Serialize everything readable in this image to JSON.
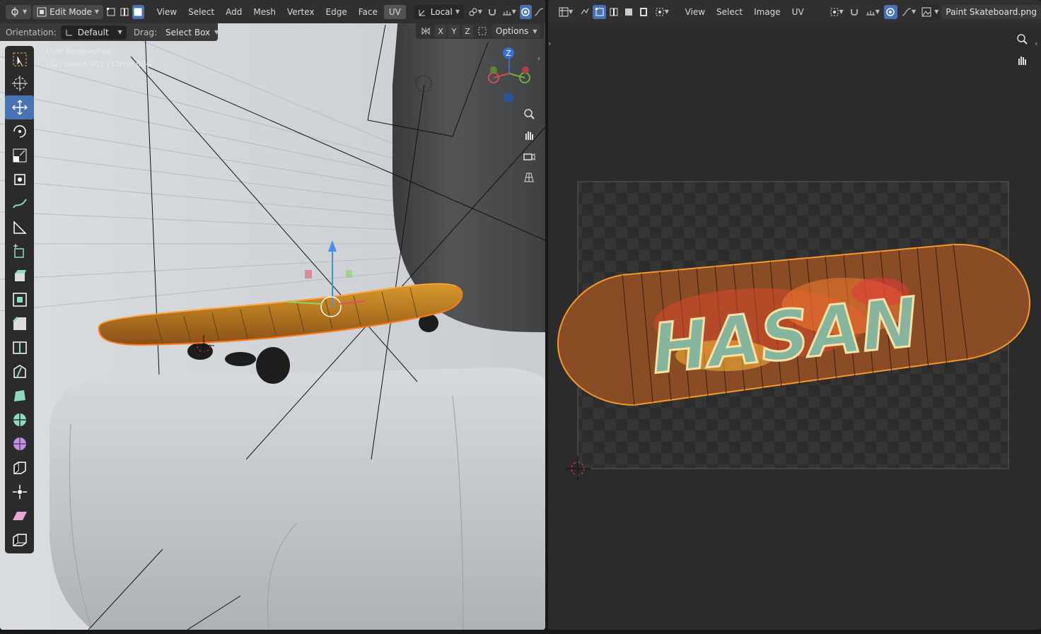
{
  "viewport": {
    "mode_label": "Edit Mode",
    "menus": [
      "View",
      "Select",
      "Add",
      "Mesh",
      "Vertex",
      "Edge",
      "Face",
      "UV"
    ],
    "active_menu_index": 7,
    "transform_orientation": "Local",
    "orientation_label": "Orientation:",
    "orientation_value": "Default",
    "drag_label": "Drag:",
    "drag_value": "Select Box",
    "options_label": "Options",
    "axes": [
      "X",
      "Y",
      "Z"
    ],
    "view_name": "User Perspective",
    "object_info": "(32) board.001 | Circle.004",
    "gizmo_axis_label": "Z",
    "tools": [
      "select-box-icon",
      "cursor-icon",
      "move-icon",
      "rotate-icon",
      "scale-icon",
      "transform-icon",
      "annotate-icon",
      "measure-icon",
      "add-cube-icon",
      "extrude-icon",
      "inset-icon",
      "bevel-icon",
      "loop-cut-icon",
      "knife-icon",
      "poly-build-icon",
      "spin-icon",
      "smooth-icon",
      "edge-slide-icon",
      "shrink-fatten-icon",
      "shear-icon",
      "rip-region-icon"
    ],
    "active_tool_index": 2
  },
  "uv_editor": {
    "menus": [
      "View",
      "Select",
      "Image",
      "UV"
    ],
    "image_name": "Paint Skateboard.png",
    "deck_text": "HASAN"
  },
  "colors": {
    "accent": "#4772b3",
    "selection_orange": "#ff9f2a",
    "header_bg": "#303030",
    "uv_bg": "#2b2b2b"
  }
}
